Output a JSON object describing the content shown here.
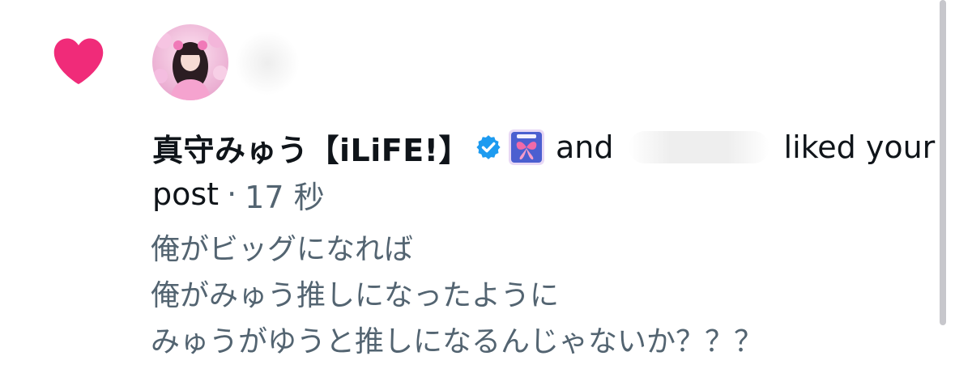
{
  "notification": {
    "type_icon": "heart-icon",
    "actor": {
      "display_name": "真守みゅう【iLiFE!】",
      "verified": true,
      "badge_icon": "ilife-badge-icon",
      "avatar_icon": "profile-photo"
    },
    "connector": "and",
    "action_text": "liked your",
    "object_text": "post",
    "separator": "·",
    "timestamp": "17 秒",
    "post_lines": [
      "俺がビッグになれば",
      "俺がみゅう推しになったように",
      "みゅうがゆうと推しになるんじゃないか？？？"
    ]
  },
  "colors": {
    "heart": "#f02b79",
    "verified": "#1d9bf0",
    "primary_text": "#0f1419",
    "secondary_text": "#536471"
  }
}
